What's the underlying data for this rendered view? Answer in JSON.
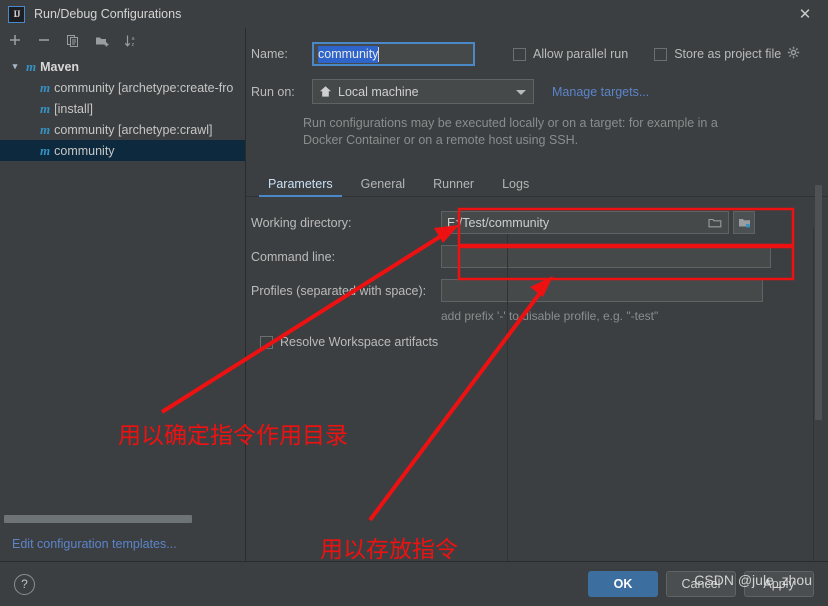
{
  "window": {
    "title": "Run/Debug Configurations",
    "app_icon": "IJ",
    "close_icon": "✕"
  },
  "sidebar": {
    "toolbar": [
      {
        "name": "add-configuration-button",
        "glyph": "+"
      },
      {
        "name": "remove-configuration-button",
        "glyph": "−"
      },
      {
        "name": "copy-configuration-button",
        "glyph": "copy-icon"
      },
      {
        "name": "new-folder-button",
        "glyph": "folder-add-icon"
      },
      {
        "name": "sort-configurations-button",
        "glyph": "sort-az-icon"
      }
    ],
    "tree": [
      {
        "label": "Maven",
        "type": "group",
        "expanded": true,
        "icon": "m"
      },
      {
        "label": "community [archetype:create-fro",
        "type": "item",
        "icon": "m"
      },
      {
        "label": "[install]",
        "type": "item",
        "icon": "m"
      },
      {
        "label": "community [archetype:crawl]",
        "type": "item",
        "icon": "m"
      },
      {
        "label": "community",
        "type": "item",
        "icon": "m",
        "selected": true
      }
    ],
    "edit_templates_link": "Edit configuration templates..."
  },
  "form": {
    "name_label": "Name:",
    "name_value": "community",
    "allow_parallel_run": {
      "label": "Allow parallel run",
      "checked": false
    },
    "store_as_project_file": {
      "label": "Store as project file",
      "checked": false
    },
    "gear_icon": "gear-icon",
    "run_on_label": "Run on:",
    "run_on_value": "Local machine",
    "run_on_icon": "home-icon",
    "manage_targets_link": "Manage targets...",
    "description": "Run configurations may be executed locally or on a target: for example in a Docker Container or on a remote host using SSH."
  },
  "tabs": [
    {
      "label": "Parameters",
      "active": true
    },
    {
      "label": "General",
      "active": false
    },
    {
      "label": "Runner",
      "active": false
    },
    {
      "label": "Logs",
      "active": false
    }
  ],
  "parameters": {
    "working_directory": {
      "label": "Working directory:",
      "value": "E:/Test/community",
      "browse_icon": "folder-icon",
      "macro_icon": "insert-macro-icon"
    },
    "command_line": {
      "label": "Command line:",
      "value": "",
      "placeholder": ""
    },
    "profiles": {
      "label": "Profiles (separated with space):",
      "value": "",
      "placeholder": "",
      "hint": "add prefix '-' to disable profile, e.g. \"-test\""
    },
    "resolve_workspace_artifacts": {
      "label": "Resolve Workspace artifacts",
      "checked": false
    }
  },
  "footer": {
    "help_label": "?",
    "ok_label": "OK",
    "cancel_label": "Cancel",
    "apply_label": "Apply"
  },
  "annotations": {
    "note_working_directory": "用以确定指令作用目录",
    "note_command_line": "用以存放指令",
    "highlight_color": "#ee1111"
  },
  "watermark": "CSDN @jule_zhou"
}
